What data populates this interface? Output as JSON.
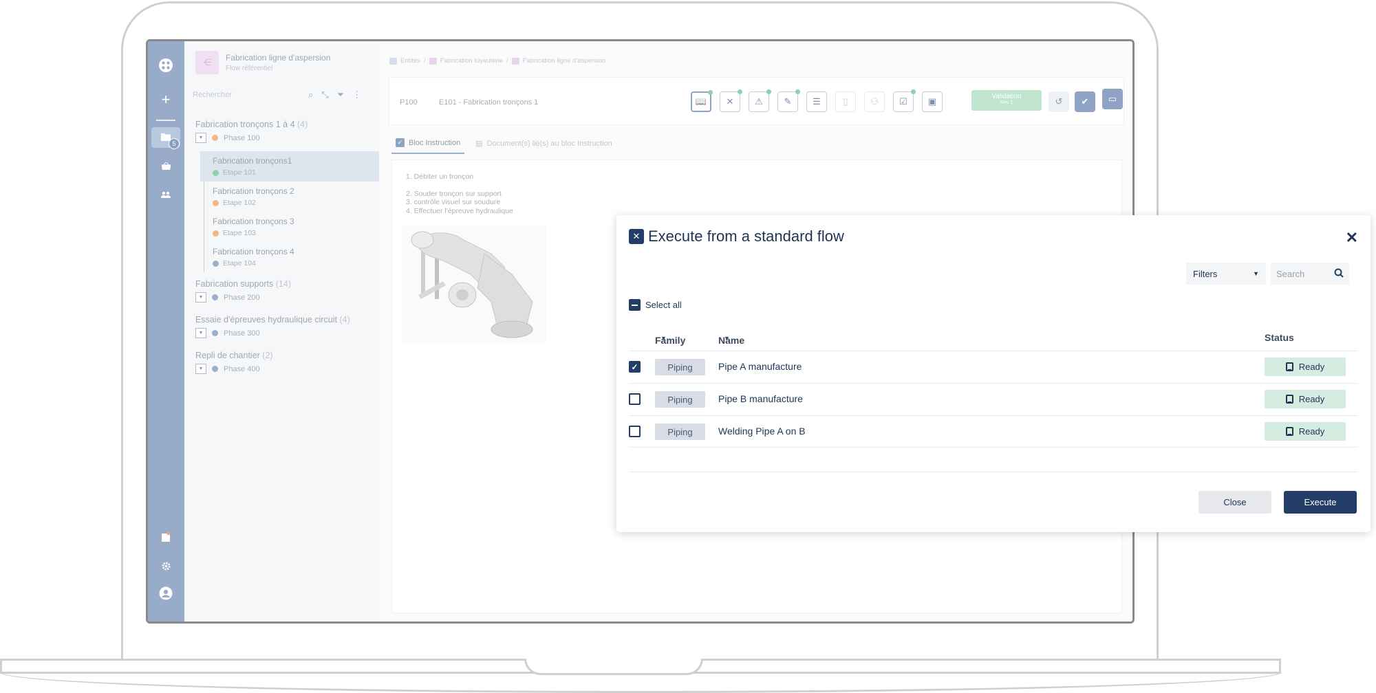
{
  "sidebar": {
    "title": "Fabrication ligne d'aspersion",
    "subtitle": "Flow référentiel",
    "search_placeholder": "Rechercher",
    "rail_badge": "5",
    "groups": [
      {
        "label": "Fabrication tronçons 1 à 4",
        "count": "(4)",
        "phase": "Phase 100",
        "phase_color": "#f0b88a"
      },
      {
        "label": "Fabrication supports",
        "count": "(14)",
        "phase": "Phase 200",
        "phase_color": "#9cb0cc"
      },
      {
        "label": "Essaie d'épreuves hydraulique circuit",
        "count": "(4)",
        "phase": "Phase 300",
        "phase_color": "#9cb0cc"
      },
      {
        "label": "Repli de chantier",
        "count": "(2)",
        "phase": "Phase 400",
        "phase_color": "#9cb0cc"
      }
    ],
    "steps": [
      {
        "label": "Fabrication tronçons1",
        "step": "Etape 101",
        "color": "#92d0ad"
      },
      {
        "label": "Fabrication tronçons 2",
        "step": "Etape 102",
        "color": "#f0b88a"
      },
      {
        "label": "Fabrication tronçons 3",
        "step": "Etape 103",
        "color": "#f0b88a"
      },
      {
        "label": "Fabrication tronçons 4",
        "step": "Etape 104",
        "color": "#9cb0cc"
      }
    ]
  },
  "breadcrumb": {
    "items": [
      "Entités",
      "Fabrication tuyauterie",
      "Fabrication ligne d'aspersion"
    ],
    "sep": "/"
  },
  "toolbar": {
    "code": "P100",
    "name": "E101 - Fabrication tronçons 1",
    "validation_label": "Validation",
    "validation_sub": "Rev 1"
  },
  "tabs": {
    "instruction": "Bloc Instruction",
    "documents": "Document(s) lié(s) au bloc Instruction"
  },
  "instructions": [
    "1. Débiter un tronçon",
    "",
    "2. Souder tronçon sur support",
    "3. contrôle visuel sur soudure",
    "4. Effectuer l'épreuve hydraulique"
  ],
  "modal": {
    "title": "Execute from a standard flow",
    "filters_label": "Filters",
    "search_placeholder": "Search",
    "select_all": "Select all",
    "columns": {
      "family": "Family",
      "name": "Name",
      "status": "Status"
    },
    "rows": [
      {
        "checked": true,
        "family": "Piping",
        "name": "Pipe A manufacture",
        "status": "Ready"
      },
      {
        "checked": false,
        "family": "Piping",
        "name": "Pipe B manufacture",
        "status": "Ready"
      },
      {
        "checked": false,
        "family": "Piping",
        "name": "Welding Pipe A on B",
        "status": "Ready"
      }
    ],
    "close_label": "Close",
    "execute_label": "Execute"
  },
  "colors": {
    "accent": "#223e67",
    "rail": "#98acca",
    "ready_bg": "#d5ede0",
    "validation_bg": "#bfe5cf"
  }
}
